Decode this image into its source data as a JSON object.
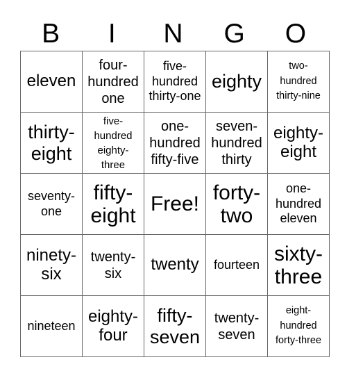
{
  "header": {
    "letters": [
      "B",
      "I",
      "N",
      "G",
      "O"
    ]
  },
  "card": {
    "rows": [
      [
        "eleven",
        "four-\nhundred\none",
        "five-\nhundred\nthirty-one",
        "eighty",
        "two-\nhundred\nthirty-nine"
      ],
      [
        "thirty-\neight",
        "five-\nhundred\neighty-\nthree",
        "one-\nhundred\nfifty-five",
        "seven-\nhundred\nthirty",
        "eighty-\neight"
      ],
      [
        "seventy-\none",
        "fifty-\neight",
        "Free!",
        "forty-\ntwo",
        "one-\nhundred\neleven"
      ],
      [
        "ninety-\nsix",
        "twenty-\nsix",
        "twenty",
        "fourteen",
        "sixty-\nthree"
      ],
      [
        "nineteen",
        "eighty-\nfour",
        "fifty-\nseven",
        "twenty-\nseven",
        "eight-\nhundred\nforty-three"
      ]
    ],
    "free_space_label": "Free!"
  }
}
